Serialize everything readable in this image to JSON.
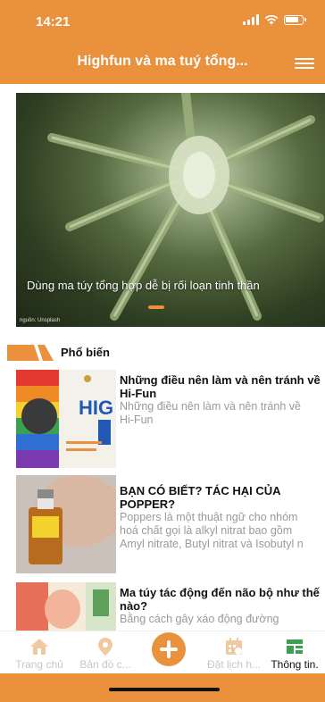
{
  "status_bar": {
    "time": "14:21"
  },
  "header": {
    "title": "Highfun và ma tuý tổng..."
  },
  "banner": {
    "caption": "Dùng ma túy tổng hợp dễ bị rối loạn tinh thần",
    "credit": "nguồn: Unsplash"
  },
  "section": {
    "title": "Phổ biến"
  },
  "articles": [
    {
      "title_line1": "Những điều nên làm và nên tránh về",
      "title_line2": "Hi-Fun",
      "desc_line1": "Những điều nên làm và nên tránh về",
      "desc_line2": "Hi-Fun",
      "thumb_text": "HIG"
    },
    {
      "title_line1": "BẠN CÓ BIẾT? TÁC HẠI CỦA",
      "title_line2": "POPPER?",
      "desc_line1": "Poppers là một thuật ngữ cho nhóm",
      "desc_line2": "hoá chất gọi là alkyl nitrat bao gồm",
      "desc_line3": "Amyl nitrate, Butyl nitrat và Isobutyl n"
    },
    {
      "title_line1": "Ma túy tác động đến não bộ như thế",
      "title_line2": "nào?",
      "desc_line1": "Bằng cách gây xáo động đường"
    }
  ],
  "tabs": [
    {
      "label": "Trang chủ",
      "icon": "home-icon"
    },
    {
      "label": "Bản đồ c...",
      "icon": "map-pin-icon"
    },
    {
      "label": "Đặt lịch h...",
      "icon": "calendar-icon"
    },
    {
      "label": "Thông tin.",
      "icon": "news-icon"
    }
  ],
  "colors": {
    "accent": "#e9913d",
    "muted_text": "#9a9a9a"
  }
}
